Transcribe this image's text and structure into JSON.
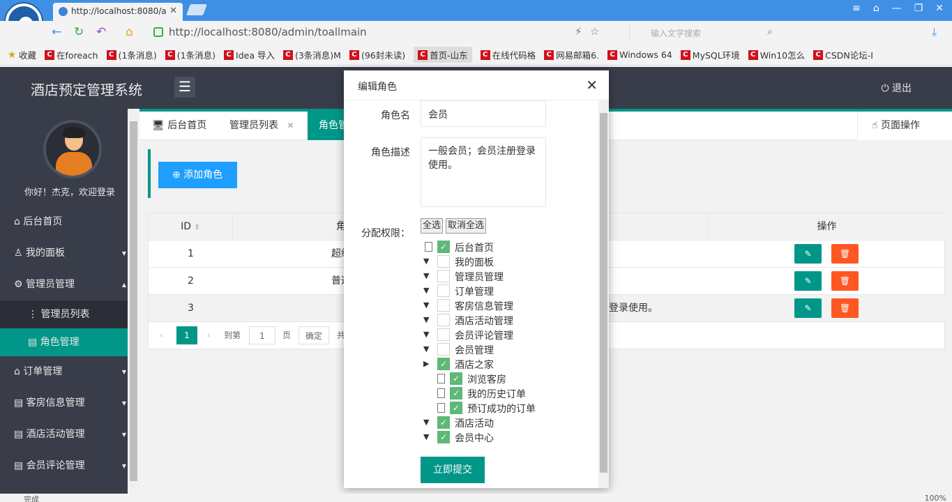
{
  "browser": {
    "tab_title": "http://localhost:8080/a",
    "url": "http://localhost:8080/admin/toallmain",
    "search_placeholder": "输入文字搜索",
    "bookmarks": [
      "收藏",
      "在foreach",
      "(1条消息)",
      "(1条消息)",
      "Idea 导入",
      "(3条消息)M",
      "(96封未读)",
      "首页-山东",
      "在线代码格",
      "网易邮箱6.",
      "Windows 64",
      "MySQL环境",
      "Win10怎么",
      "CSDN论坛-I"
    ],
    "status_text": "完成",
    "zoom": "100%"
  },
  "header": {
    "brand": "酒店预定管理系统",
    "menu_icon": "☰",
    "logout": "⏻ 退出"
  },
  "sidebar": {
    "welcome": "你好！杰克，欢迎登录",
    "items": [
      {
        "label": "⌂ 后台首页"
      },
      {
        "label": "♙ 我的面板"
      },
      {
        "label": "⚙ 管理员管理"
      },
      {
        "label": "⋮ 管理员列表"
      },
      {
        "label": "▤ 角色管理"
      },
      {
        "label": "⌂ 订单管理"
      },
      {
        "label": "▤ 客房信息管理"
      },
      {
        "label": "▤ 酒店活动管理"
      },
      {
        "label": "▤ 会员评论管理"
      }
    ]
  },
  "tabs": {
    "home": "🖥 后台首页",
    "admin_list": "管理员列表",
    "admin_list_close": "✕",
    "role": "角色管",
    "page_ops": "☝ 页面操作"
  },
  "content": {
    "add_button": "⊕ 添加角色",
    "table": {
      "headers": [
        "ID",
        "角",
        "操作"
      ],
      "rows": [
        {
          "id": "1",
          "name": "超级",
          "desc": ""
        },
        {
          "id": "2",
          "name": "普通",
          "desc": ""
        },
        {
          "id": "3",
          "name": "会",
          "desc": "登录使用。"
        }
      ]
    },
    "pager": {
      "current": "1",
      "goto_label": "到第",
      "page_input": "1",
      "page_unit": "页",
      "confirm": "确定",
      "total_prefix": "共"
    }
  },
  "modal": {
    "title": "编辑角色",
    "role_name_label": "角色名",
    "role_name_value": "会员",
    "role_desc_label": "角色描述",
    "role_desc_value": "一般会员；会员注册登录使用。",
    "perm_label": "分配权限：",
    "select_all": "全选",
    "deselect_all": "取消全选",
    "tree": [
      {
        "label": "后台首页",
        "checked": true,
        "kind": "file"
      },
      {
        "label": "我的面板",
        "checked": false,
        "kind": "open"
      },
      {
        "label": "管理员管理",
        "checked": false,
        "kind": "open"
      },
      {
        "label": "订单管理",
        "checked": false,
        "kind": "open"
      },
      {
        "label": "客房信息管理",
        "checked": false,
        "kind": "open"
      },
      {
        "label": "酒店活动管理",
        "checked": false,
        "kind": "open"
      },
      {
        "label": "会员评论管理",
        "checked": false,
        "kind": "open"
      },
      {
        "label": "会员管理",
        "checked": false,
        "kind": "open"
      },
      {
        "label": "酒店之家",
        "checked": true,
        "kind": "closed"
      },
      {
        "label": "浏览客房",
        "checked": true,
        "kind": "child"
      },
      {
        "label": "我的历史订单",
        "checked": true,
        "kind": "child"
      },
      {
        "label": "预订成功的订单",
        "checked": true,
        "kind": "child"
      },
      {
        "label": "酒店活动",
        "checked": true,
        "kind": "open"
      },
      {
        "label": "会员中心",
        "checked": true,
        "kind": "open"
      }
    ],
    "submit": "立即提交"
  },
  "colors": {
    "accent": "#009688",
    "danger": "#ff5722",
    "primary": "#1e9fff",
    "dark": "#393d49"
  }
}
